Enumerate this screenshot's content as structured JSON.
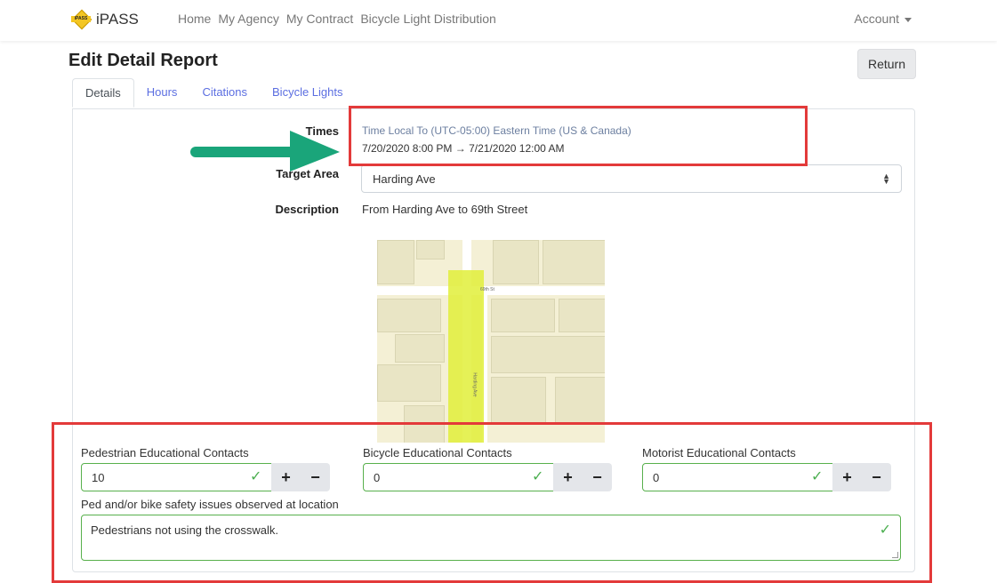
{
  "nav": {
    "brand": "iPASS",
    "logo_text": "iPASS",
    "links": [
      "Home",
      "My Agency",
      "My Contract",
      "Bicycle Light Distribution"
    ],
    "account": "Account"
  },
  "page": {
    "title": "Edit Detail Report",
    "return_label": "Return"
  },
  "tabs": [
    {
      "label": "Details",
      "active": true
    },
    {
      "label": "Hours",
      "active": false
    },
    {
      "label": "Citations",
      "active": false
    },
    {
      "label": "Bicycle Lights",
      "active": false
    }
  ],
  "details": {
    "times_label": "Times",
    "times_timezone": "Time Local To (UTC-05:00) Eastern Time (US & Canada)",
    "times_range": "7/20/2020 8:00 PM → 7/21/2020 12:00 AM",
    "target_area_label": "Target Area",
    "target_area_value": "Harding Ave",
    "description_label": "Description",
    "description_value": "From Harding Ave to 69th Street",
    "map_street_label": "69th St",
    "map_avenue_label": "Harding Ave"
  },
  "contacts": {
    "pedestrian": {
      "label": "Pedestrian Educational Contacts",
      "value": "10"
    },
    "bicycle": {
      "label": "Bicycle Educational Contacts",
      "value": "0"
    },
    "motorist": {
      "label": "Motorist Educational Contacts",
      "value": "0"
    },
    "plus_symbol": "+",
    "minus_symbol": "−"
  },
  "issues": {
    "label": "Ped and/or bike safety issues observed at location",
    "value": "Pedestrians not using the crosswalk."
  },
  "colors": {
    "highlight_red": "#e33a3a",
    "arrow_green": "#1aa57a",
    "valid_green": "#58b04c",
    "link_blue": "#5b6ee1"
  }
}
